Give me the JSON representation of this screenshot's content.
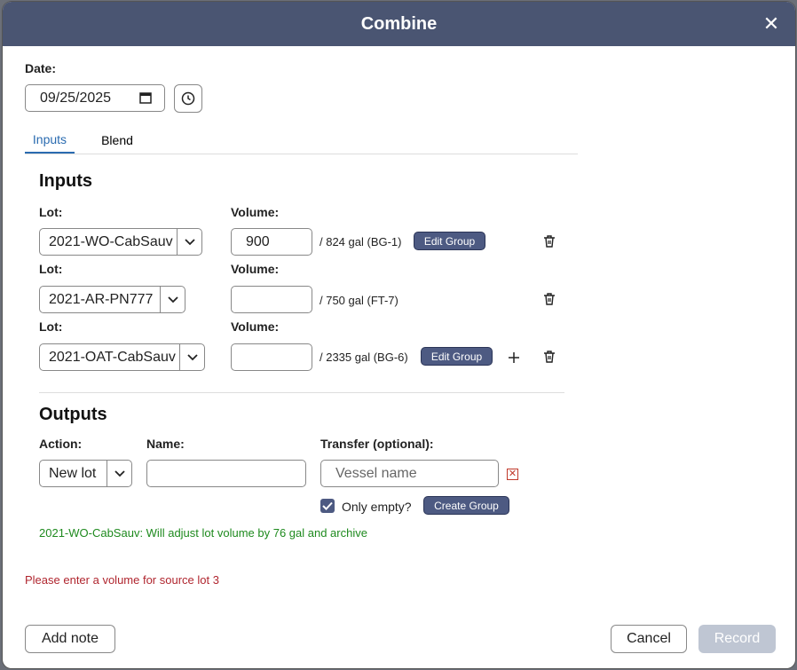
{
  "modal": {
    "title": "Combine"
  },
  "date": {
    "label": "Date:",
    "value": "09/25/2025"
  },
  "tabs": [
    {
      "label": "Inputs",
      "active": true
    },
    {
      "label": "Blend",
      "active": false
    }
  ],
  "inputs": {
    "heading": "Inputs",
    "lot_label": "Lot:",
    "volume_label": "Volume:",
    "edit_group_label": "Edit Group",
    "rows": [
      {
        "lot": "2021-WO-CabSauv",
        "volume": "900",
        "capacity": "/ 824 gal (BG-1)",
        "edit_group": true,
        "add": false
      },
      {
        "lot": "2021-AR-PN777",
        "volume": "",
        "capacity": "/ 750 gal (FT-7)",
        "edit_group": false,
        "add": false
      },
      {
        "lot": "2021-OAT-CabSauv",
        "volume": "",
        "capacity": "/ 2335 gal (BG-6)",
        "edit_group": true,
        "add": true
      }
    ]
  },
  "outputs": {
    "heading": "Outputs",
    "action_label": "Action:",
    "action_value": "New lot",
    "name_label": "Name:",
    "name_value": "",
    "transfer_label": "Transfer (optional):",
    "vessel_placeholder": "Vessel name",
    "only_empty_label": "Only empty?",
    "only_empty_checked": true,
    "create_group_label": "Create Group"
  },
  "messages": {
    "info": "2021-WO-CabSauv: Will adjust lot volume by 76 gal and archive",
    "error": "Please enter a volume for source lot 3"
  },
  "footer": {
    "add_note": "Add note",
    "cancel": "Cancel",
    "record": "Record"
  },
  "colors": {
    "header": "#4a5572",
    "accent": "#2a6bb0",
    "button": "#4d5a82",
    "success": "#1e8a1e",
    "error": "#b0262f"
  }
}
